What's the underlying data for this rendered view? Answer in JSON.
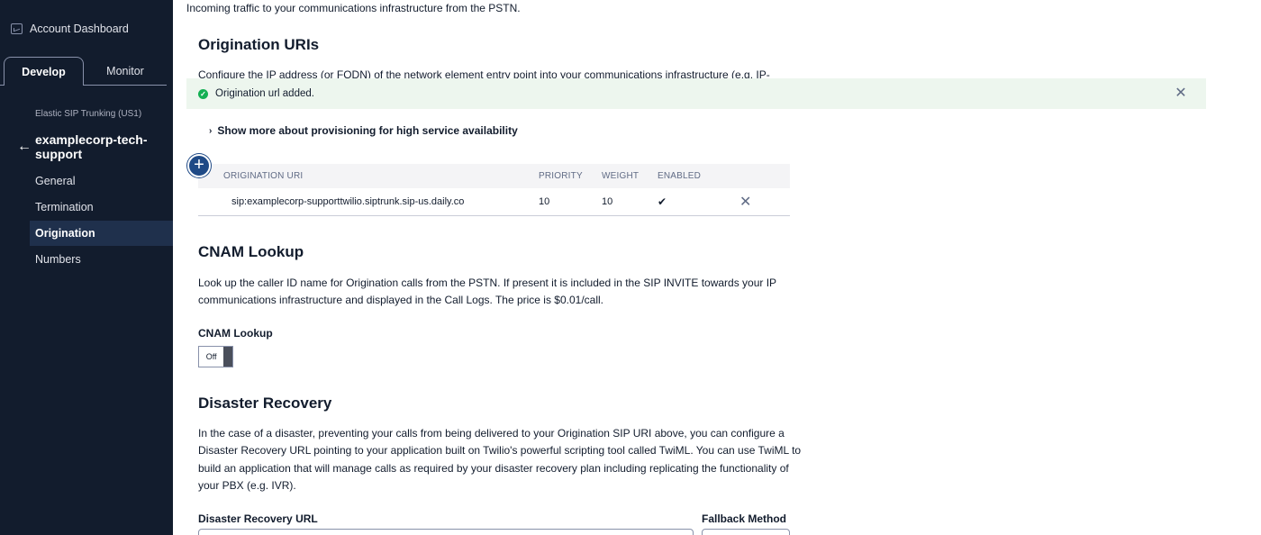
{
  "sidebar": {
    "account_dashboard": "Account Dashboard",
    "tabs": [
      {
        "label": "Develop"
      },
      {
        "label": "Monitor"
      }
    ],
    "product": "Elastic SIP Trunking (US1)",
    "trunk_name": "examplecorp-tech-support",
    "nav": [
      {
        "label": "General"
      },
      {
        "label": "Termination"
      },
      {
        "label": "Origination"
      },
      {
        "label": "Numbers"
      }
    ]
  },
  "main": {
    "intro": "Incoming traffic to your communications infrastructure from the PSTN.",
    "origination": {
      "title": "Origination URIs",
      "description": "Configure the IP address (or FQDN) of the network element entry point into your communications infrastructure (e.g. IP-PBX,",
      "toast": "Origination url added.",
      "show_more": "Show more about provisioning for high service availability",
      "table": {
        "headers": [
          "ORIGINATION URI",
          "PRIORITY",
          "WEIGHT",
          "ENABLED"
        ],
        "rows": [
          {
            "uri": "sip:examplecorp-supporttwilio.siptrunk.sip-us.daily.co",
            "priority": "10",
            "weight": "10",
            "enabled": "✔"
          }
        ]
      }
    },
    "cnam": {
      "title": "CNAM Lookup",
      "line1": "Look up the caller ID name for Origination calls from the PSTN. If present it is included in the SIP INVITE towards your IP",
      "line2": "communications infrastructure and displayed in the Call Logs. The price is $0.01/call.",
      "label": "CNAM Lookup",
      "toggle": "Off"
    },
    "disaster": {
      "title": "Disaster Recovery",
      "line1": "In the case of a disaster, preventing your calls from being delivered to your Origination SIP URI above, you can configure a",
      "line2": "Disaster Recovery URL pointing to your application built on Twilio's powerful scripting tool called TwiML. You can use TwiML to",
      "line3": "build an application that will manage calls as required by your disaster recovery plan including replicating the functionality of",
      "line4": "your PBX (e.g. IVR).",
      "url_label": "Disaster Recovery URL",
      "method_label": "Fallback Method"
    }
  },
  "icons": {
    "toast_check": "check-circle-icon",
    "close": "close-icon",
    "add": "plus-icon",
    "back": "arrow-left-icon",
    "dashboard": "dashboard-icon"
  },
  "colors": {
    "sidebar_bg": "#121c2d",
    "sidebar_active": "#1f304c",
    "toast_bg": "#edf6ee",
    "success": "#14b053",
    "add_button": "#1f4a86"
  }
}
